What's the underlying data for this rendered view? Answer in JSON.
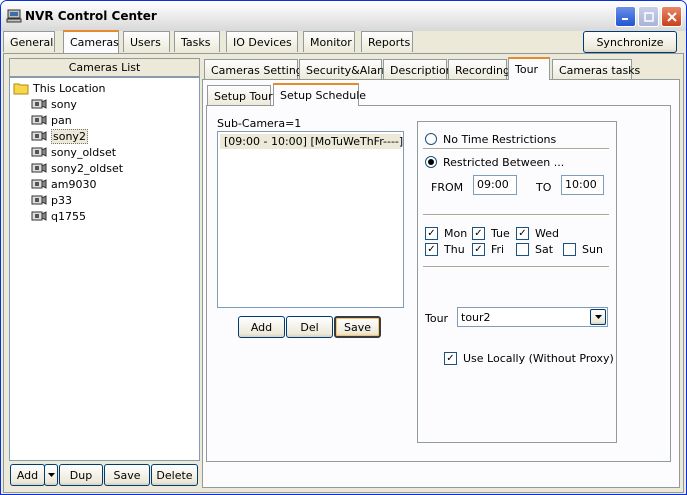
{
  "window": {
    "title": "NVR Control Center"
  },
  "main_tabs": [
    "General",
    "Cameras",
    "Users",
    "Tasks",
    "IO Devices",
    "Monitor",
    "Reports"
  ],
  "synchronize_label": "Synchronize",
  "cameras_list": {
    "header": "Cameras List",
    "root": "This Location",
    "items": [
      "sony",
      "pan",
      "sony2",
      "sony_oldset",
      "sony2_oldset",
      "am9030",
      "p33",
      "q1755"
    ],
    "selected": "sony2"
  },
  "list_buttons": {
    "add": "Add",
    "dup": "Dup",
    "save": "Save",
    "delete": "Delete"
  },
  "sub_tabs": [
    "Cameras Settings",
    "Security&Alarm",
    "Description",
    "Recording",
    "Tour",
    "Cameras tasks"
  ],
  "tour_tabs": [
    "Setup Tour",
    "Setup Schedule"
  ],
  "schedule": {
    "sub_camera_label": "Sub-Camera=1",
    "entries": [
      "[09:00 - 10:00] [MoTuWeThFr----]"
    ],
    "buttons": {
      "add": "Add",
      "del": "Del",
      "save": "Save"
    }
  },
  "restrictions": {
    "no_time_label": "No Time Restrictions",
    "restricted_label": "Restricted Between ...",
    "from_label": "FROM",
    "from_value": "09:00",
    "to_label": "TO",
    "to_value": "10:00"
  },
  "days": {
    "mon": "Mon",
    "tue": "Tue",
    "wed": "Wed",
    "thu": "Thu",
    "fri": "Fri",
    "sat": "Sat",
    "sun": "Sun"
  },
  "tour_field": {
    "label": "Tour",
    "value": "tour2"
  },
  "use_locally_label": "Use Locally (Without Proxy)"
}
